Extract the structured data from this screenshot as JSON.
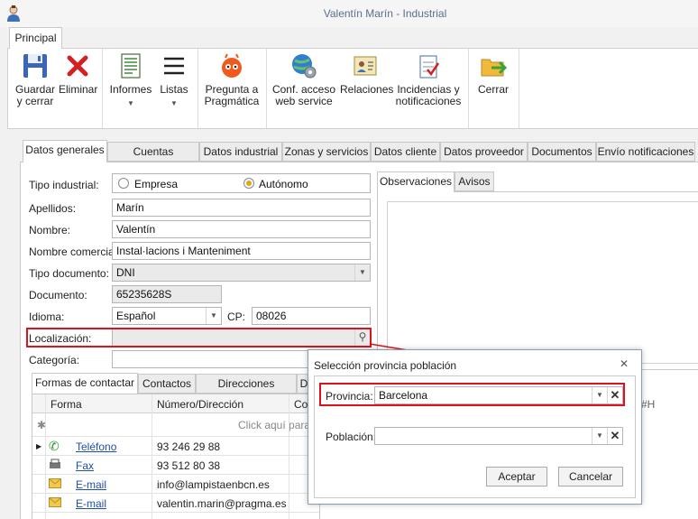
{
  "window": {
    "title": "Valentín Marín - Industrial"
  },
  "ribbon": {
    "tab": "Principal",
    "buttons": [
      {
        "label1": "Guardar",
        "label2": "y cerrar",
        "icon": "save-icon"
      },
      {
        "label1": "Eliminar",
        "label2": "",
        "icon": "delete-icon"
      },
      {
        "label1": "Informes",
        "label2": "",
        "icon": "reports-icon",
        "dropdown": true
      },
      {
        "label1": "Listas",
        "label2": "",
        "icon": "lists-icon",
        "dropdown": true
      },
      {
        "label1": "Pregunta a",
        "label2": "Pragmática",
        "icon": "robot-icon"
      },
      {
        "label1": "Conf. acceso",
        "label2": "web service",
        "icon": "globe-gear-icon"
      },
      {
        "label1": "Relaciones",
        "label2": "",
        "icon": "contacts-card-icon"
      },
      {
        "label1": "Incidencias y",
        "label2": "notificaciones",
        "icon": "checklist-icon"
      },
      {
        "label1": "Cerrar",
        "label2": "",
        "icon": "folder-exit-icon"
      }
    ]
  },
  "tabs": [
    "Datos generales",
    "Cuentas bancarias",
    "Datos industrial",
    "Zonas y servicios",
    "Datos cliente",
    "Datos proveedor",
    "Documentos",
    "Envío notificaciones"
  ],
  "form": {
    "tipo_industrial_label": "Tipo industrial:",
    "option_empresa": "Empresa",
    "option_autonomo": "Autónomo",
    "apellidos_label": "Apellidos:",
    "apellidos_value": "Marín",
    "nombre_label": "Nombre:",
    "nombre_value": "Valentín",
    "nombre_comercial_label": "Nombre comercial:",
    "nombre_comercial_value": "Instal·lacions i Manteniment",
    "tipo_documento_label": "Tipo documento:",
    "tipo_documento_value": "DNI",
    "documento_label": "Documento:",
    "documento_value": "65235628S",
    "idioma_label": "Idioma:",
    "idioma_value": "Español",
    "cp_label": "CP:",
    "cp_value": "08026",
    "localizacion_label": "Localización:",
    "localizacion_value": "",
    "categoria_label": "Categoría:"
  },
  "side_tabs": [
    "Observaciones",
    "Avisos"
  ],
  "sub_tabs": [
    "Formas de contactar",
    "Contactos",
    "Direcciones postales",
    "D"
  ],
  "grid": {
    "columns": [
      "Forma",
      "Número/Dirección",
      "Co"
    ],
    "new_row_hint": "Click aquí para a",
    "rows": [
      {
        "forma": "Teléfono",
        "valor": "93 246 29 88",
        "icon": "phone-icon"
      },
      {
        "forma": "Fax",
        "valor": "93 512 80 38",
        "icon": "fax-icon"
      },
      {
        "forma": "E-mail",
        "valor": "info@lampistaenbcn.es",
        "icon": "email-icon"
      },
      {
        "forma": "E-mail",
        "valor": "valentin.marin@pragma.es",
        "icon": "email-icon"
      }
    ],
    "right_fragment": "#H"
  },
  "dialog": {
    "title": "Selección provincia población",
    "provincia_label": "Provincia:",
    "provincia_value": "Barcelona",
    "poblacion_label": "Población:",
    "poblacion_value": "",
    "accept": "Aceptar",
    "cancel": "Cancelar"
  },
  "colors": {
    "highlight": "#d9141b",
    "link": "#1f4fa8",
    "radio_selected": "#e8a317"
  }
}
